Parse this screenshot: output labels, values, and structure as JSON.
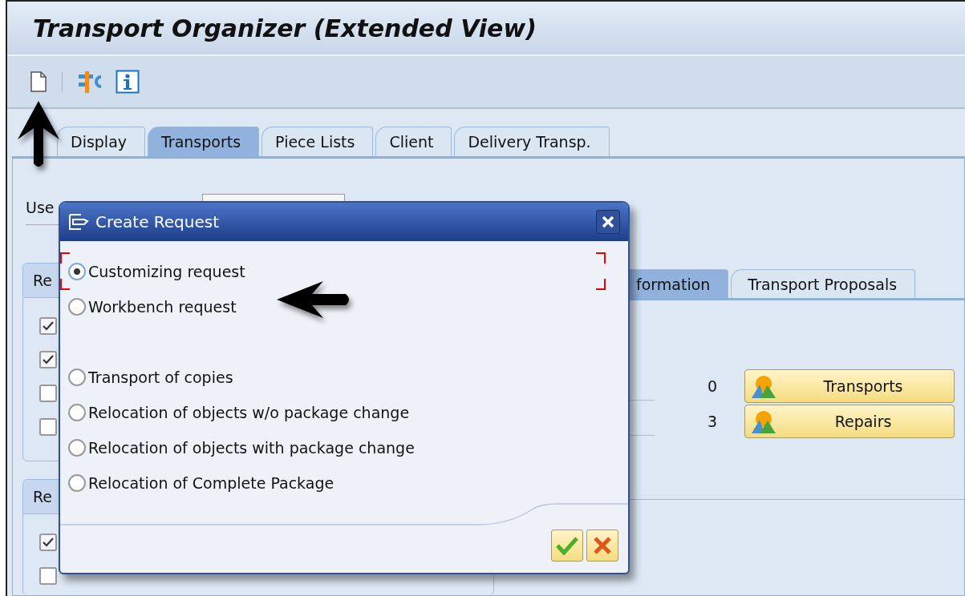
{
  "window": {
    "title": "Transport Organizer (Extended View)"
  },
  "tabs": [
    {
      "label": "Display",
      "selected": false
    },
    {
      "label": "Transports",
      "selected": true
    },
    {
      "label": "Piece Lists",
      "selected": false
    },
    {
      "label": "Client",
      "selected": false
    },
    {
      "label": "Delivery Transp.",
      "selected": false
    }
  ],
  "user_label": "Use",
  "groups": [
    {
      "title": "Re",
      "checkboxes": [
        {
          "checked": true
        },
        {
          "checked": true
        },
        {
          "checked": false
        },
        {
          "checked": false
        }
      ]
    },
    {
      "title": "Re",
      "checkboxes": [
        {
          "checked": true
        },
        {
          "checked": false
        }
      ]
    }
  ],
  "detail_tabs": [
    {
      "label": "formation",
      "selected": true
    },
    {
      "label": "Transport Proposals",
      "selected": false
    }
  ],
  "counts": [
    {
      "value": "0",
      "button": "Transports"
    },
    {
      "value": "3",
      "button": "Repairs"
    }
  ],
  "dialog": {
    "title": "Create Request",
    "option_groups": [
      [
        {
          "label": "Customizing request",
          "selected": true
        },
        {
          "label": "Workbench request",
          "selected": false
        }
      ],
      [
        {
          "label": "Transport of copies",
          "selected": false
        },
        {
          "label": "Relocation of objects w/o package change",
          "selected": false
        },
        {
          "label": "Relocation of objects with package change",
          "selected": false
        },
        {
          "label": "Relocation of Complete Package",
          "selected": false
        }
      ]
    ]
  }
}
